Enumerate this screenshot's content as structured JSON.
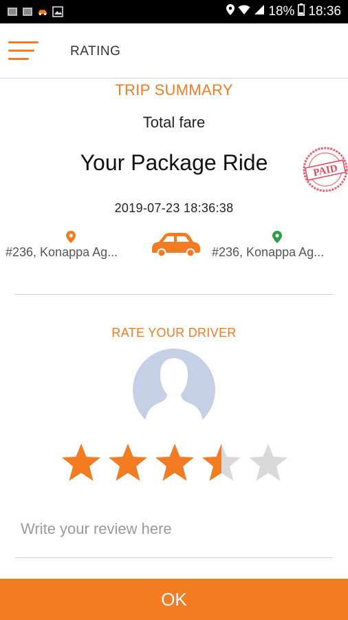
{
  "status_bar": {
    "battery": "18%",
    "time": "18:36",
    "left_icons": [
      "photo-icon",
      "photo-icon",
      "car-notification-icon",
      "gallery-icon"
    ]
  },
  "app_bar": {
    "title": "RATING",
    "menu_icon": "hamburger-menu-icon"
  },
  "trip": {
    "section_title": "TRIP SUMMARY",
    "fare_label": "Total fare",
    "ride_title": "Your Package Ride",
    "paid_stamp": "PAID",
    "date": "2019-07-23 18:36:38",
    "pickup_address": "#236, Konappa Ag...",
    "drop_address": "#236, Konappa Ag..."
  },
  "rating": {
    "section_title": "RATE YOUR DRIVER",
    "stars_total": 5,
    "stars_value": 3.5,
    "review_placeholder": "Write your review here"
  },
  "actions": {
    "ok_label": "OK"
  },
  "colors": {
    "accent": "#f37c22",
    "star_empty": "#d9d9d9",
    "pickup_pin": "#f37c22",
    "drop_pin": "#2e9e47",
    "avatar_bg": "#c5d0e6",
    "stamp": "#e2485a"
  }
}
